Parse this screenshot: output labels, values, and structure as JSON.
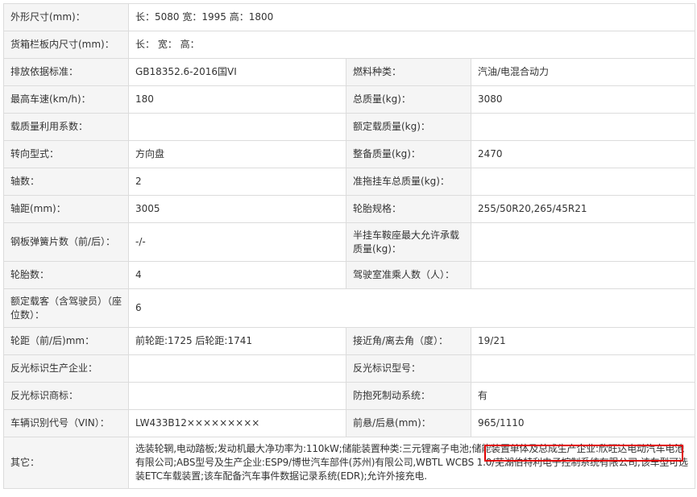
{
  "rows": [
    {
      "l1": "外形尺寸(mm)：",
      "v1": "长：5080 宽：1995 高：1800"
    },
    {
      "l1": "货箱栏板内尺寸(mm)：",
      "v1": "长： 宽： 高："
    },
    {
      "l1": "排放依据标准：",
      "v1": "GB18352.6-2016国VI",
      "l2": "燃料种类：",
      "v2": "汽油/电混合动力"
    },
    {
      "l1": "最高车速(km/h)：",
      "v1": "180",
      "l2": "总质量(kg)：",
      "v2": "3080"
    },
    {
      "l1": "载质量利用系数：",
      "v1": "",
      "l2": "额定载质量(kg)：",
      "v2": ""
    },
    {
      "l1": "转向型式：",
      "v1": "方向盘",
      "l2": "整备质量(kg)：",
      "v2": "2470"
    },
    {
      "l1": "轴数：",
      "v1": "2",
      "l2": "准拖挂车总质量(kg)：",
      "v2": ""
    },
    {
      "l1": "轴距(mm)：",
      "v1": "3005",
      "l2": "轮胎规格：",
      "v2": "255/50R20,265/45R21"
    },
    {
      "l1": "钢板弹簧片数（前/后）：",
      "v1": "-/-",
      "l2": "半挂车鞍座最大允许承载质量(kg)：",
      "v2": ""
    },
    {
      "l1": "轮胎数：",
      "v1": "4",
      "l2": "驾驶室准乘人数（人）：",
      "v2": ""
    },
    {
      "l1": "额定载客（含驾驶员）（座位数）：",
      "v1": "6"
    },
    {
      "l1": "轮距（前/后)mm：",
      "v1": "前轮距:1725 后轮距:1741",
      "l2": "接近角/离去角（度）：",
      "v2": "19/21"
    },
    {
      "l1": "反光标识生产企业：",
      "v1": "",
      "l2": "反光标识型号：",
      "v2": ""
    },
    {
      "l1": "反光标识商标：",
      "v1": "",
      "l2": "防抱死制动系统：",
      "v2": "有"
    },
    {
      "l1": "车辆识别代号（VIN）：",
      "v1": "LW433B12×××××××××",
      "l2": "前悬/后悬(mm)：",
      "v2": "965/1110"
    }
  ],
  "other": {
    "label": "其它：",
    "text": "选装轮辋,电动踏板;发动机最大净功率为:110kW;储能装置种类:三元锂离子电池;储能装置单体及总成生产企业:欣旺达电动汽车电池有限公司;ABS型号及生产企业:ESP9/博世汽车部件(苏州)有限公司,WBTL WCBS 1.0/芜湖伯特利电子控制系统有限公司;该车型可选装ETC车载装置;该车配备汽车事件数据记录系统(EDR);允许外接充电."
  },
  "colors": {
    "label_bg": "#f5f5f5",
    "border": "#dcdcdc",
    "highlight": "#e00000"
  }
}
